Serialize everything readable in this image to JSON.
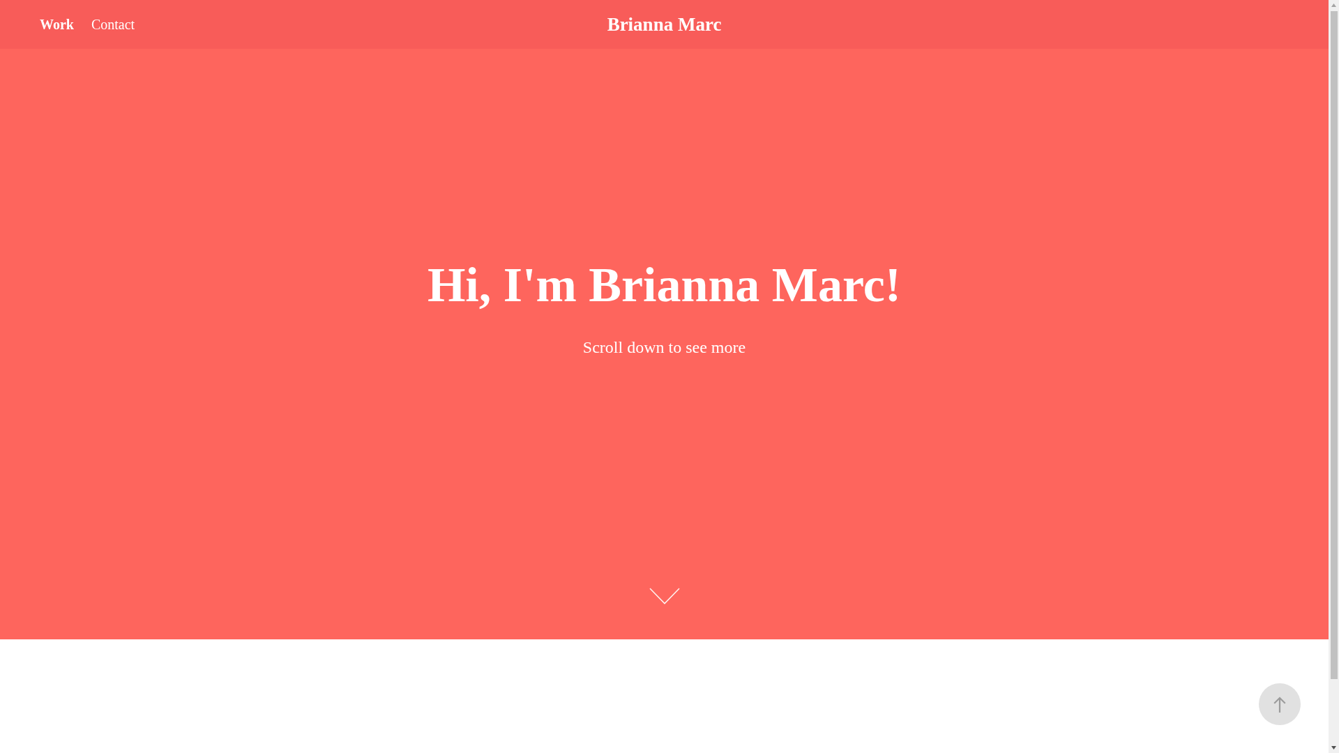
{
  "header": {
    "nav": [
      {
        "label": "Work",
        "selected": true
      },
      {
        "label": "Contact",
        "selected": false
      }
    ],
    "title": "Brianna Marc"
  },
  "hero": {
    "heading": "Hi, I'm Brianna Marc!",
    "subheading": "Scroll down to see more"
  }
}
